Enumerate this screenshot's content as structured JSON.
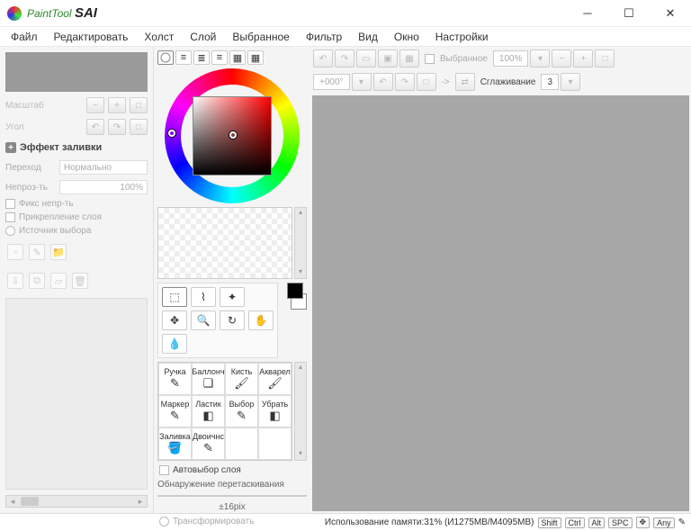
{
  "window": {
    "title_prefix": "PaintTool",
    "title_suffix": "SAI"
  },
  "menu": {
    "items": [
      "Файл",
      "Редактировать",
      "Холст",
      "Слой",
      "Выбранное",
      "Фильтр",
      "Вид",
      "Окно",
      "Настройки"
    ]
  },
  "left": {
    "scale_label": "Масштаб",
    "angle_label": "Угол",
    "section": "Эффект заливки",
    "blend_label": "Переход",
    "blend_value": "Нормально",
    "opacity_label": "Непроз-ть",
    "opacity_value": "100%",
    "opt1": "Фикс непр-ть",
    "opt2": "Прикрепление слоя",
    "opt3": "Источник выбора"
  },
  "brushes": {
    "items": [
      {
        "name": "Ручка"
      },
      {
        "name": "Баллонч"
      },
      {
        "name": "Кисть"
      },
      {
        "name": "Акварел"
      },
      {
        "name": "Маркер"
      },
      {
        "name": "Ластик"
      },
      {
        "name": "Выбор"
      },
      {
        "name": "Убрать"
      },
      {
        "name": "Заливка"
      },
      {
        "name": "Двоичнс"
      }
    ],
    "auto_select": "Автовыбор слоя",
    "drag_detect": "Обнаружение перетаскивания",
    "drag_value": "±16pix",
    "transform": "Трансформировать"
  },
  "right": {
    "sel_label": "Выбранное",
    "zoom": "100%",
    "angle": "+000°",
    "arrow": "->",
    "smooth_label": "Сглаживание",
    "smooth_value": "3"
  },
  "status": {
    "mem": "Использование памяти:31% (И1275MB/M4095MB)",
    "keys": [
      "Shift",
      "Ctrl",
      "Alt",
      "SPC",
      "✥",
      "Any"
    ],
    "pen": "✎"
  }
}
